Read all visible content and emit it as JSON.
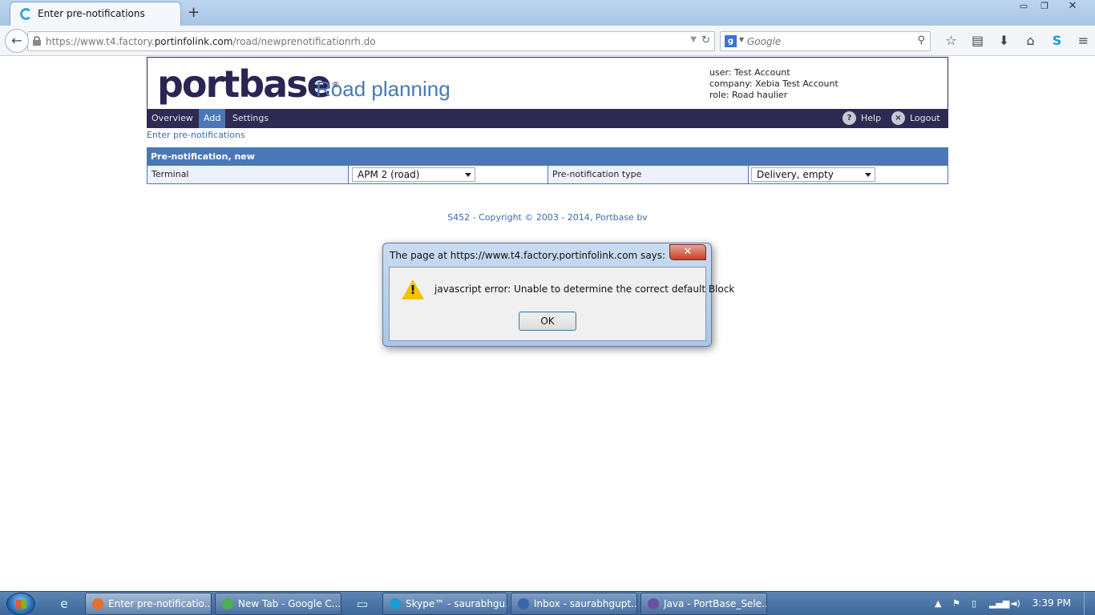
{
  "browser": {
    "tab_title": "Enter pre-notifications",
    "new_tab": "+",
    "window_controls": {
      "minimize": "▭",
      "restore": "❐",
      "close": "✕"
    },
    "url_prefix": "https://www.t4.factory.",
    "url_domain": "portinfolink.com",
    "url_path": "/road/newprenotificationrh.do",
    "search_placeholder": "Google",
    "search_engine_icon": "g",
    "icons": [
      "back-icon",
      "lock-icon",
      "reload-icon",
      "search-icon",
      "star-icon",
      "reader-icon",
      "download-icon",
      "home-icon",
      "skype-icon",
      "menu-icon"
    ]
  },
  "header": {
    "logo": "portbase",
    "logo_mark": "®",
    "app_title": "Road planning",
    "user_line": "user: Test Account",
    "company_line": "company: Xebia Test Account",
    "role_line": "role: Road haulier"
  },
  "menu": {
    "items": [
      "Overview",
      "Add",
      "Settings"
    ],
    "active": "Add",
    "help": "Help",
    "help_icon": "?",
    "logout": "Logout",
    "logout_icon": "×"
  },
  "breadcrumb": "Enter pre-notifications",
  "form": {
    "section_title": "Pre-notification, new",
    "terminal_label": "Terminal",
    "terminal_value": "APM 2 (road)",
    "type_label": "Pre-notification type",
    "type_value": "Delivery, empty"
  },
  "footer": {
    "copyright": "S452 - Copyright © 2003 - 2014, Portbase bv"
  },
  "dialog": {
    "title": "The page at https://www.t4.factory.portinfolink.com says:",
    "close": "✕",
    "warning_mark": "!",
    "message": "javascript error: Unable to determine the correct default Block",
    "ok": "OK"
  },
  "taskbar": {
    "windows": [
      {
        "label": "Enter pre-notificatio...",
        "color": "#e8702a"
      },
      {
        "label": "New Tab - Google C...",
        "color": "#4caf50"
      },
      {
        "label": "Skype™ - saurabhgu...",
        "color": "#1d9ad8"
      },
      {
        "label": "Inbox - saurabhgupt...",
        "color": "#3a66b0"
      },
      {
        "label": "Java - PortBase_Sele...",
        "color": "#6b4fa0"
      }
    ],
    "time": "3:39 PM"
  },
  "colors": {
    "brand_dark": "#2f2a52",
    "brand_blue": "#4a78b7",
    "link_blue": "#3a6cae"
  }
}
